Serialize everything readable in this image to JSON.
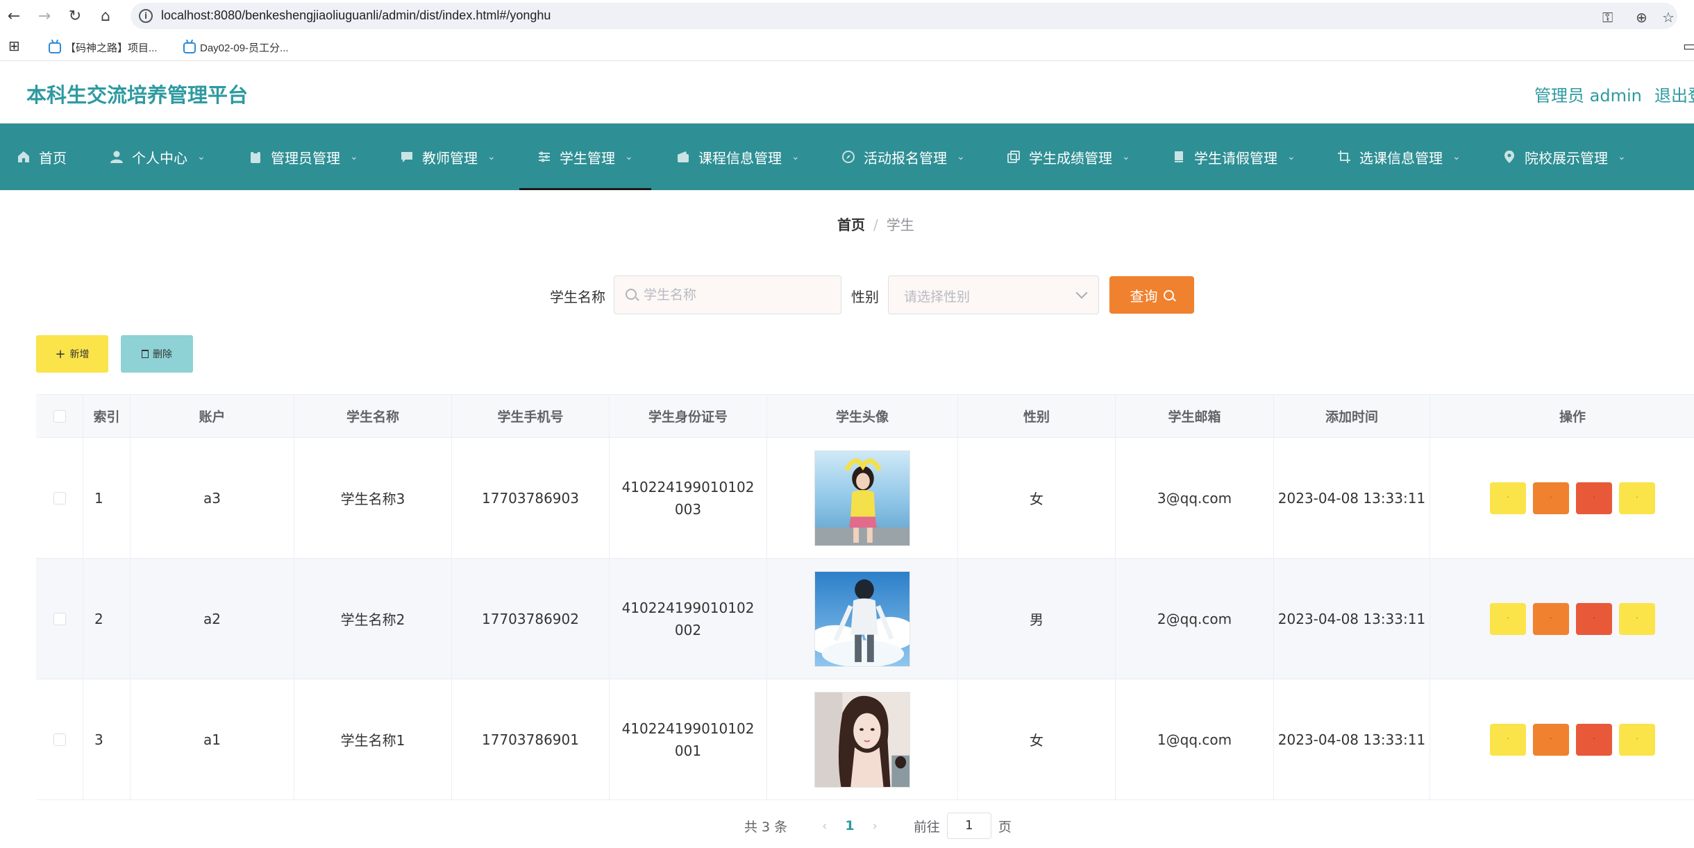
{
  "browser": {
    "url": "localhost:8080/benkeshengjiaoliuguanli/admin/dist/index.html#/yonghu",
    "bookmarks": [
      {
        "label": "【码神之路】项目..."
      },
      {
        "label": "Day02-09-员工分..."
      }
    ]
  },
  "header": {
    "title": "本科生交流培养管理平台",
    "admin": "管理员 admin",
    "logout": "退出登录"
  },
  "nav": {
    "items": [
      {
        "label": "首页",
        "icon": "home-icon",
        "dropdown": false
      },
      {
        "label": "个人中心",
        "icon": "user-icon",
        "dropdown": true
      },
      {
        "label": "管理员管理",
        "icon": "clipboard-icon",
        "dropdown": true
      },
      {
        "label": "教师管理",
        "icon": "chat-icon",
        "dropdown": true
      },
      {
        "label": "学生管理",
        "icon": "sliders-icon",
        "dropdown": true,
        "active": true
      },
      {
        "label": "课程信息管理",
        "icon": "wallet-icon",
        "dropdown": true
      },
      {
        "label": "活动报名管理",
        "icon": "compass-icon",
        "dropdown": true
      },
      {
        "label": "学生成绩管理",
        "icon": "copy-icon",
        "dropdown": true
      },
      {
        "label": "学生请假管理",
        "icon": "bookmark-icon",
        "dropdown": true
      },
      {
        "label": "选课信息管理",
        "icon": "crop-icon",
        "dropdown": true
      },
      {
        "label": "院校展示管理",
        "icon": "location-icon",
        "dropdown": true
      }
    ]
  },
  "breadcrumb": {
    "home": "首页",
    "separator": "/",
    "current": "学生"
  },
  "search": {
    "name_label": "学生名称",
    "name_placeholder": "学生名称",
    "gender_label": "性别",
    "gender_placeholder": "请选择性别",
    "query_label": "查询"
  },
  "actions": {
    "add_label": "新增",
    "delete_label": "删除"
  },
  "table": {
    "headers": [
      "索引",
      "账户",
      "学生名称",
      "学生手机号",
      "学生身份证号",
      "学生头像",
      "性别",
      "学生邮箱",
      "添加时间",
      "操作"
    ],
    "rows": [
      {
        "index": "1",
        "account": "a3",
        "name": "学生名称3",
        "phone": "17703786903",
        "idcard": "410224199010102003",
        "avatar": "photo-girl-yellow-sweater",
        "gender": "女",
        "email": "3@qq.com",
        "time": "2023-04-08 13:33:11"
      },
      {
        "index": "2",
        "account": "a2",
        "name": "学生名称2",
        "phone": "17703786902",
        "idcard": "410224199010102002",
        "avatar": "illustration-boy-sky",
        "gender": "男",
        "email": "2@qq.com",
        "time": "2023-04-08 13:33:11"
      },
      {
        "index": "3",
        "account": "a1",
        "name": "学生名称1",
        "phone": "17703786901",
        "idcard": "410224199010102001",
        "avatar": "illustration-girl-portrait",
        "gender": "女",
        "email": "1@qq.com",
        "time": "2023-04-08 13:33:11"
      }
    ],
    "op_buttons": [
      "·",
      "·",
      "·",
      "·"
    ]
  },
  "pagination": {
    "total": "共 3 条",
    "current": "1",
    "goto_prefix": "前往",
    "goto_value": "1",
    "goto_suffix": "页"
  },
  "colors": {
    "primary": "#2e9aa0",
    "nav_bg": "#2e8f94",
    "query_btn": "#f0812e",
    "add_btn": "#fbe34a",
    "delete_btn": "#8ed2d5",
    "op_red": "#e8593a"
  }
}
